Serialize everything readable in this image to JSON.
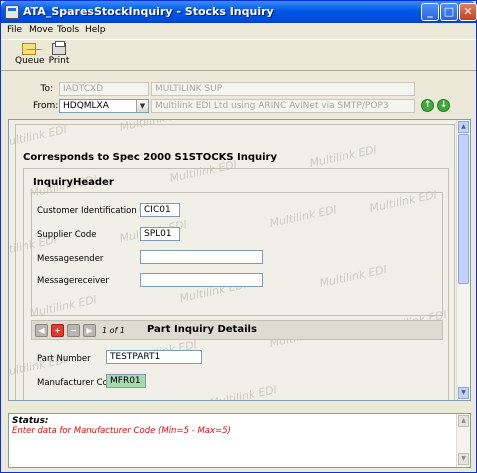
{
  "window": {
    "title": "ATA_SparesStockInquiry - Stocks Inquiry",
    "minimize": "_",
    "maximize": "□",
    "close": "✕"
  },
  "menu": [
    "File",
    "Move",
    "Tools",
    "Help"
  ],
  "toolbar": {
    "queue_label": "Queue",
    "print_label": "Print"
  },
  "header": {
    "to_label": "To:",
    "to_code": "IADTCXD",
    "to_name": "MULTILINK SUP",
    "from_label": "From:",
    "from_code": "HDQMLXA",
    "from_desc": "Multilink EDI Ltd using ARINC AviNet via SMTP/POP3"
  },
  "watermark_text": "Multilink EDI",
  "form": {
    "spec_title": "Corresponds to Spec 2000 S1STOCKS Inquiry",
    "inquiry_header_title": "InquiryHeader",
    "customer_id_label": "Customer Identification Code",
    "customer_id_value": "CIC01",
    "supplier_code_label": "Supplier Code",
    "supplier_code_value": "SPL01",
    "messagesender_label": "Messagesender",
    "messagesender_value": "",
    "messagereceiver_label": "Messagereceiver",
    "messagereceiver_value": "",
    "record_counter": "1 of 1",
    "part_details_title": "Part Inquiry Details",
    "part_number_label": "Part Number",
    "part_number_value": "TESTPART1",
    "manufacturer_code_label": "Manufacturer Code",
    "manufacturer_code_value": "MFR01"
  },
  "status": {
    "title": "Status:",
    "message": "Enter data for Manufacturer Code (Min=5 - Max=5)"
  },
  "colors": {
    "title_bar": "#0058e6",
    "status_error": "#e01010",
    "active_field": "#a8d8b0"
  }
}
